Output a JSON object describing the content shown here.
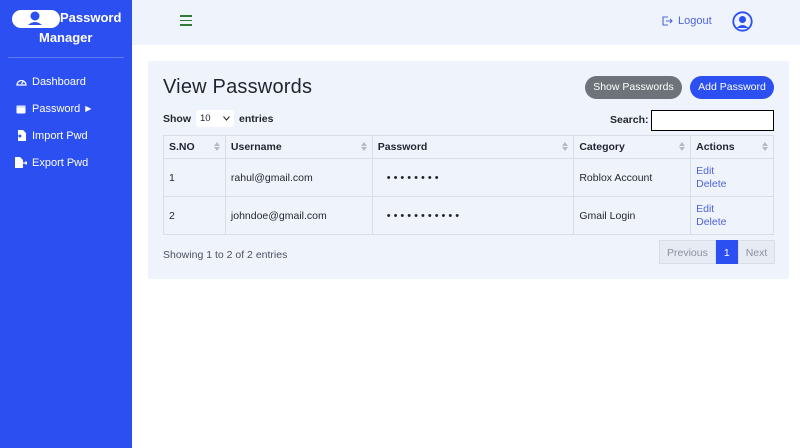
{
  "brand": {
    "line1": "Password",
    "line2": "Manager"
  },
  "nav": [
    {
      "label": "Dashboard",
      "icon": "gauge-icon"
    },
    {
      "label": "Password",
      "icon": "calendar-icon"
    },
    {
      "label": "Import Pwd",
      "icon": "file-import-icon"
    },
    {
      "label": "Export Pwd",
      "icon": "file-export-icon"
    }
  ],
  "topbar": {
    "logout_label": "Logout"
  },
  "page": {
    "title": "View Passwords",
    "show_passwords_label": "Show Passwords",
    "add_password_label": "Add Password"
  },
  "entries": {
    "show_label": "Show",
    "selected": "10",
    "entries_label": "entries"
  },
  "search": {
    "label": "Search:",
    "value": ""
  },
  "table": {
    "headers": [
      "S.NO",
      "Username",
      "Password",
      "Category",
      "Actions"
    ],
    "rows": [
      {
        "sno": "1",
        "username": "rahul@gmail.com",
        "password": "••••••••",
        "category": "Roblox Account",
        "edit": "Edit",
        "delete": "Delete"
      },
      {
        "sno": "2",
        "username": "johndoe@gmail.com",
        "password": "•••••••••••",
        "category": "Gmail Login",
        "edit": "Edit",
        "delete": "Delete"
      }
    ]
  },
  "footer": {
    "info": "Showing 1 to 2 of 2 entries",
    "previous": "Previous",
    "page": "1",
    "next": "Next"
  },
  "colors": {
    "primary": "#2b4ff0",
    "grey_button": "#6d7378",
    "panel": "#eff4fc"
  }
}
